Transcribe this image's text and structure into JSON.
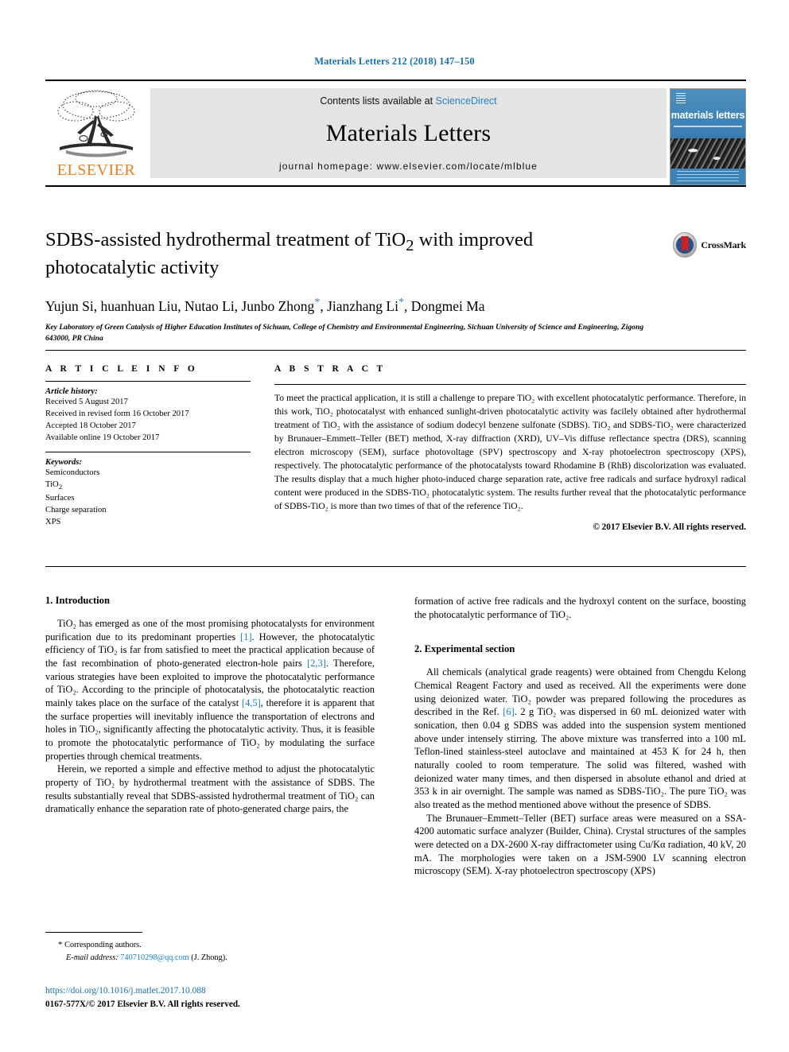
{
  "running_head": "Materials Letters 212 (2018) 147–150",
  "masthead": {
    "contents_prefix": "Contents lists available at ",
    "sciencedirect": "ScienceDirect",
    "journal_name": "Materials Letters",
    "homepage": "journal homepage: www.elsevier.com/locate/mlblue",
    "publisher_wordmark": "ELSEVIER",
    "cover_title": "materials letters",
    "accent_link_color": "#2a7fc1",
    "band_bg_color": "#e4e4e4",
    "elsevier_orange": "#ef7d22"
  },
  "article": {
    "title": "SDBS-assisted hydrothermal treatment of TiO2 with improved photocatalytic activity",
    "title_line1_a": "SDBS-assisted hydrothermal treatment of TiO",
    "title_line1_sub": "2",
    "title_line1_b": " with improved",
    "title_line2": "photocatalytic activity",
    "crossmark_label": "CrossMark",
    "authors_part1": "Yujun Si, huanhuan Liu, Nutao Li, Junbo Zhong",
    "authors_part2": ", Jianzhang Li",
    "authors_part3": ", Dongmei Ma",
    "author_star": "*",
    "affiliation": "Key Laboratory of Green Catalysis of Higher Education Institutes of Sichuan, College of Chemistry and Environmental Engineering, Sichuan University of Science and Engineering, Zigong 643000, PR China"
  },
  "article_info": {
    "heading": "A R T I C L E   I N F O",
    "history_label": "Article history:",
    "history": [
      "Received 5 August 2017",
      "Received in revised form 16 October 2017",
      "Accepted 18 October 2017",
      "Available online 19 October 2017"
    ],
    "keywords_label": "Keywords:",
    "keywords_line1": "Semiconductors",
    "keywords_line2_a": "TiO",
    "keywords_line2_sub": "2",
    "keywords_rest": [
      "Surfaces",
      "Charge separation",
      "XPS"
    ]
  },
  "abstract": {
    "heading": "A B S T R A C T",
    "p1": "To meet the practical application, it is still a challenge to prepare TiO₂ with excellent photocatalytic performance. Therefore, in this work, TiO₂ photocatalyst with enhanced sunlight-driven photocatalytic activity was facilely obtained after hydrothermal treatment of TiO₂ with the assistance of sodium dodecyl benzene sulfonate (SDBS). TiO₂ and SDBS-TiO₂ were characterized by Brunauer–Emmett–Teller (BET) method, X-ray diffraction (XRD), UV–Vis diffuse reflectance spectra (DRS), scanning electron microscopy (SEM), surface photovoltage (SPV) spectroscopy and X-ray photoelectron spectroscopy (XPS), respectively. The photocatalytic performance of the photocatalysts toward Rhodamine B (RhB) discolorization was evaluated. The results display that a much higher photo-induced charge separation rate, active free radicals and surface hydroxyl radical content were produced in the SDBS-TiO₂ photocatalytic system. The results further reveal that the photocatalytic performance of SDBS-TiO₂ is more than two times of that of the reference TiO₂.",
    "copyright": "© 2017 Elsevier B.V. All rights reserved."
  },
  "sections": {
    "intro_heading": "1. Introduction",
    "intro_p1_a": "TiO₂ has emerged as one of the most promising photocatalysts for environment purification due to its predominant properties ",
    "intro_p1_ref1": "[1]",
    "intro_p1_b": ". However, the photocatalytic efficiency of TiO₂ is far from satisfied to meet the practical application because of the fast recombination of photo-generated electron-hole pairs ",
    "intro_p1_ref2": "[2,3]",
    "intro_p1_c": ". Therefore, various strategies have been exploited to improve the photocatalytic performance of TiO₂. According to the principle of photocatalysis, the photocatalytic reaction mainly takes place on the surface of the catalyst ",
    "intro_p1_ref3": "[4,5]",
    "intro_p1_d": ", therefore it is apparent that the surface properties will inevitably influence the transportation of electrons and holes in TiO₂, significantly affecting the photocatalytic activity. Thus, it is feasible to promote the photocatalytic performance of TiO₂ by modulating the surface properties through chemical treatments.",
    "intro_p2": "Herein, we reported a simple and effective method to adjust the photocatalytic property of TiO₂ by hydrothermal treatment with the assistance of SDBS. The results substantially reveal that SDBS-assisted hydrothermal treatment of TiO₂ can dramatically enhance the separation rate of photo-generated charge pairs, the",
    "intro_p2_cont": "formation of active free radicals and the hydroxyl content on the surface, boosting the photocatalytic performance of TiO₂.",
    "exp_heading": "2. Experimental section",
    "exp_p1_a": "All chemicals (analytical grade reagents) were obtained from Chengdu Kelong Chemical Reagent Factory and used as received. All the experiments were done using deionized water. TiO₂ powder was prepared following the procedures as described in the Ref. ",
    "exp_p1_ref": "[6]",
    "exp_p1_b": ". 2 g TiO₂ was dispersed in 60 mL deionized water with sonication, then 0.04 g SDBS was added into the suspension system mentioned above under intensely stirring. The above mixture was transferred into a 100 mL Teflon-lined stainless-steel autoclave and maintained at 453 K for 24 h, then naturally cooled to room temperature. The solid was filtered, washed with deionized water many times, and then dispersed in absolute ethanol and dried at 353 k in air overnight. The sample was named as SDBS-TiO₂. The pure TiO₂ was also treated as the method mentioned above without the presence of SDBS.",
    "exp_p2": "The Brunauer–Emmett–Teller (BET) surface areas were measured on a SSA-4200 automatic surface analyzer (Builder, China). Crystal structures of the samples were detected on a DX-2600 X-ray diffractometer using Cu/Kα radiation, 40 kV, 20 mA. The morphologies were taken on a JSM-5900 LV scanning electron microscopy (SEM). X-ray photoelectron spectroscopy (XPS)"
  },
  "footer": {
    "corresponding_star": "*",
    "corresponding_label": "Corresponding authors.",
    "email_label": "E-mail address:",
    "email": "740710298@qq.com",
    "email_owner": "(J. Zhong).",
    "doi": "https://doi.org/10.1016/j.matlet.2017.10.088",
    "issn": "0167-577X/© 2017 Elsevier B.V. All rights reserved."
  }
}
